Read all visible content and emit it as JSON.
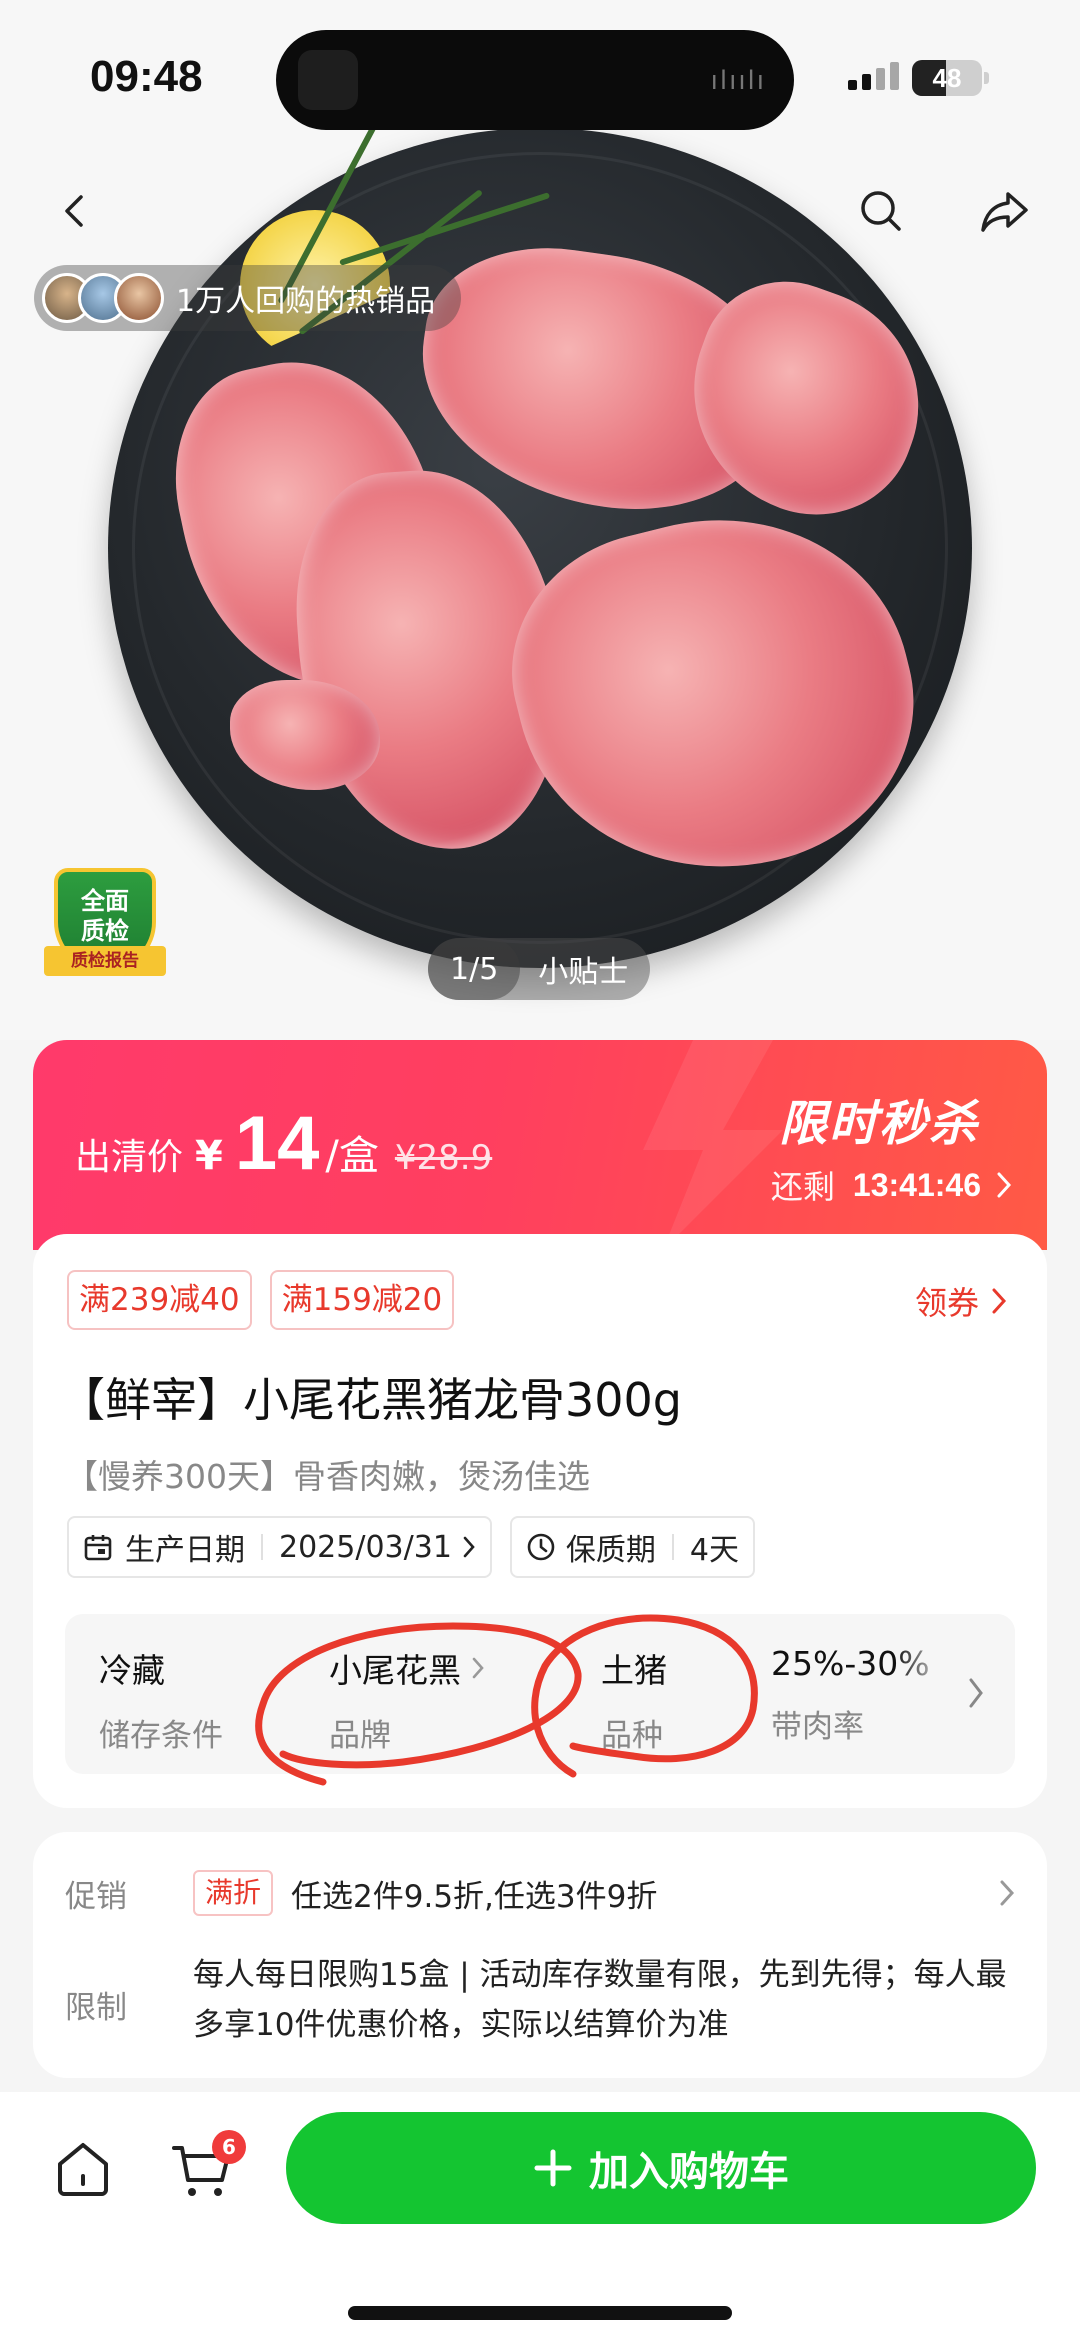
{
  "status_bar": {
    "time": "09:48",
    "battery": "48",
    "battery_level": 0.48
  },
  "hero": {
    "rebuy_text": "1万人回购的热销品",
    "qc_badge": {
      "line1": "全面",
      "line2": "质检",
      "ribbon": "质检报告"
    },
    "page_indicator": "1/5",
    "tip_label": "小贴士"
  },
  "price": {
    "label": "出清价",
    "currency": "¥",
    "value": "14",
    "unit": "/盒",
    "original": "¥28.9",
    "flash_sale_title": "限时秒杀",
    "countdown_label": "还剩",
    "countdown_time": "13:41:46"
  },
  "product": {
    "coupons": [
      "满239减40",
      "满159减20"
    ],
    "get_coupon_label": "领券",
    "title": "【鲜宰】小尾花黑猪龙骨300g",
    "subtitle": "【慢养300天】骨香肉嫩，煲汤佳选",
    "production_date_label": "生产日期",
    "production_date": "2025/03/31",
    "shelf_life_label": "保质期",
    "shelf_life": "4天",
    "specs": [
      {
        "value": "冷藏",
        "key": "储存条件"
      },
      {
        "value": "小尾花黑",
        "key": "品牌"
      },
      {
        "value": "土猪",
        "key": "品种"
      },
      {
        "value": "25%-30%",
        "key": "带肉率"
      }
    ]
  },
  "promo": {
    "promo_label": "促销",
    "promo_tag": "满折",
    "promo_text": "任选2件9.5折,任选3件9折",
    "limit_label": "限制",
    "limit_text": "每人每日限购15盒 | 活动库存数量有限，先到先得；每人最多享10件优惠价格，实际以结算价为准"
  },
  "bottom_bar": {
    "cart_count": "6",
    "add_to_cart_label": "加入购物车"
  },
  "colors": {
    "accent_green": "#14c531",
    "price_red": "#ff3a6b",
    "coupon_red": "#e8392c",
    "annotation_red": "#e8392c"
  }
}
